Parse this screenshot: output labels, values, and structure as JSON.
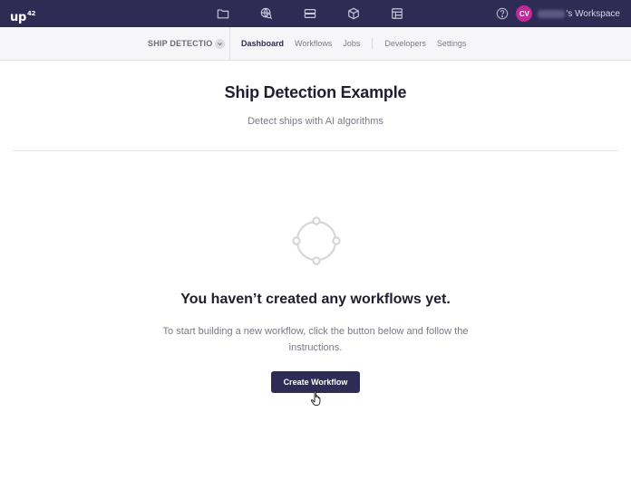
{
  "topbar": {
    "logo": "up",
    "logo_sup": "42",
    "icons": [
      "folder-icon",
      "globe-search-icon",
      "storage-icon",
      "cube-icon",
      "marketplace-icon"
    ],
    "help_icon": "question-circle-icon",
    "avatar_initials": "CV",
    "workspace_suffix": "'s Workspace",
    "colors": {
      "bar": "#2e2c55",
      "avatar": "#c02a9a"
    }
  },
  "subnav": {
    "project_name": "SHIP DETECTIO",
    "tabs": [
      "Dashboard",
      "Workflows",
      "Jobs"
    ],
    "secondary_tabs": [
      "Developers",
      "Settings"
    ],
    "active_tab": "Dashboard"
  },
  "main": {
    "title": "Ship Detection Example",
    "subtitle": "Detect ships with AI algorithms",
    "empty_state": {
      "icon": "workflow-nodes-icon",
      "title": "You haven’t created any workflows yet.",
      "text": "To start building a new workflow, click the button below and follow the instructions.",
      "button_label": "Create Workflow"
    }
  }
}
